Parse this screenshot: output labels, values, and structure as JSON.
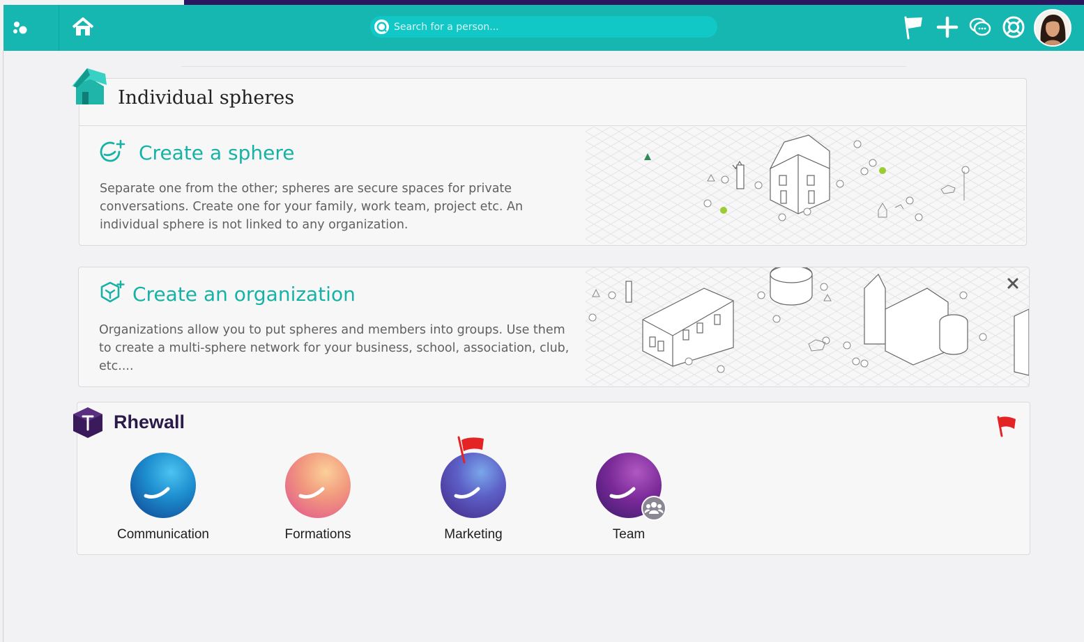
{
  "header": {
    "search": {
      "placeholder": "Search for a person..."
    },
    "icons": [
      "logo-icon",
      "home-icon",
      "flag-icon",
      "plus-icon",
      "chat-icon",
      "help-icon"
    ],
    "brand_color": "#16b7b0"
  },
  "individual_spheres": {
    "title": "Individual spheres",
    "create_sphere": {
      "title": "Create a sphere",
      "description": "Separate one from the other; spheres are secure spaces for private conversations. Create one for your family, work team, project etc. An individual sphere is not linked to any organization."
    }
  },
  "create_organization": {
    "title": "Create an organization",
    "description": "Organizations allow you to put spheres and members into groups. Use them to create a multi-sphere network for your business, school, association, club, etc...."
  },
  "organization": {
    "name": "Rhewall",
    "accent": "#3b1a5c",
    "spheres": [
      {
        "label": "Communication",
        "colors": [
          "#1e9ad6",
          "#0f3c8a"
        ],
        "flagged": false,
        "group": false
      },
      {
        "label": "Formations",
        "colors": [
          "#f7b57a",
          "#e0508c"
        ],
        "flagged": false,
        "group": false
      },
      {
        "label": "Marketing",
        "colors": [
          "#6d8de0",
          "#4a2a8a"
        ],
        "flagged": true,
        "group": false
      },
      {
        "label": "Team",
        "colors": [
          "#9a3fae",
          "#3a1a6a"
        ],
        "flagged": false,
        "group": true
      }
    ]
  }
}
